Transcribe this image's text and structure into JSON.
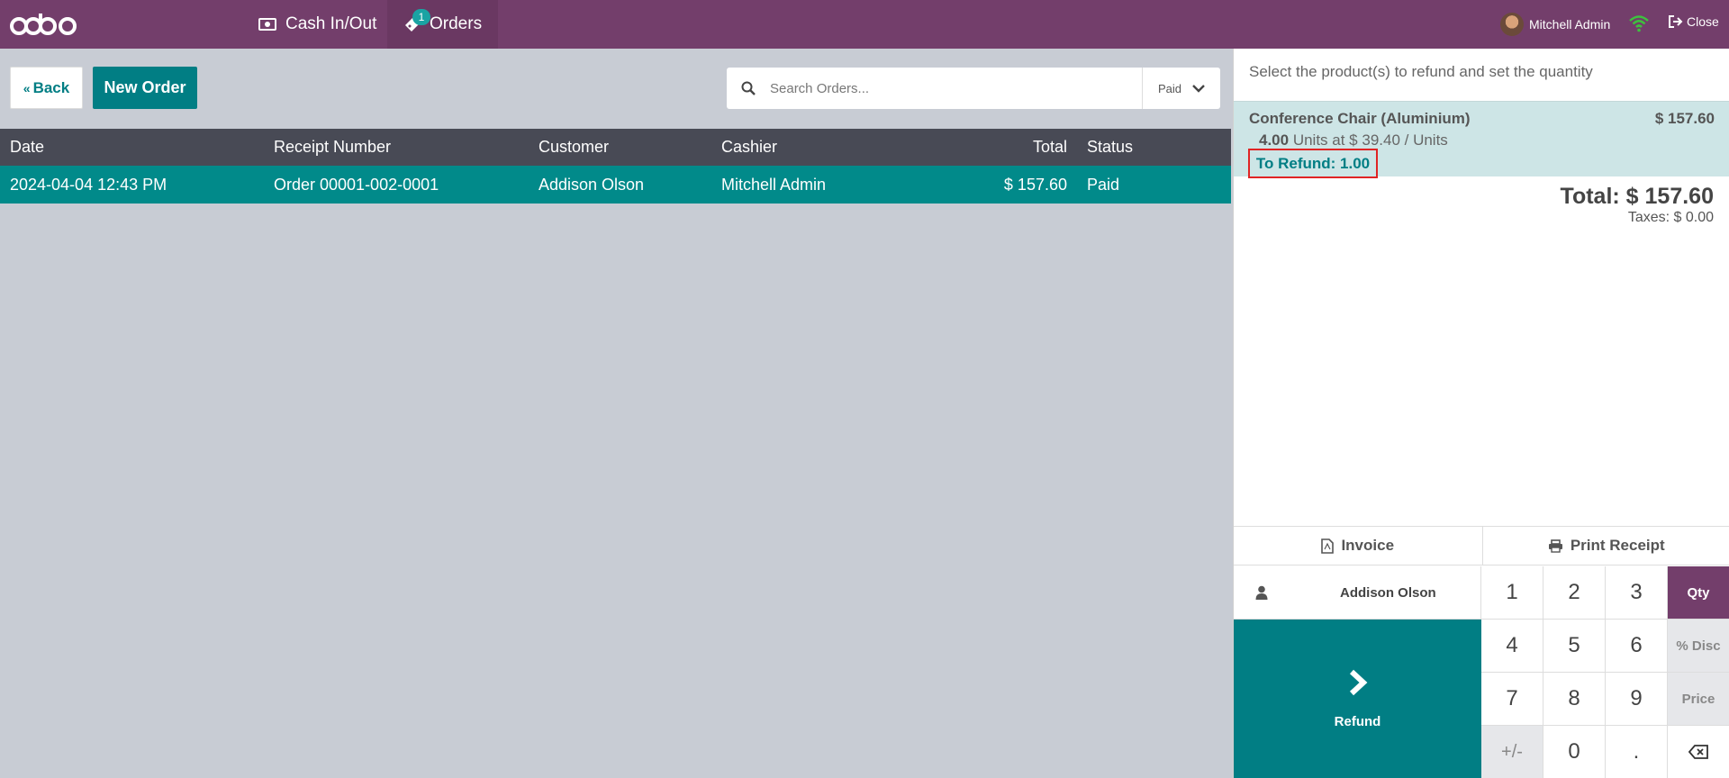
{
  "navbar": {
    "logo": "odoo",
    "cash_label": "Cash In/Out",
    "orders_label": "Orders",
    "orders_badge": "1",
    "user_name": "Mitchell Admin",
    "close_label": "Close"
  },
  "controls": {
    "back_label": "Back",
    "new_order_label": "New Order",
    "search_placeholder": "Search Orders...",
    "filter_value": "Paid"
  },
  "table": {
    "headers": {
      "date": "Date",
      "receipt": "Receipt Number",
      "customer": "Customer",
      "cashier": "Cashier",
      "total": "Total",
      "status": "Status"
    },
    "rows": [
      {
        "date": "2024-04-04 12:43 PM",
        "receipt": "Order 00001-002-0001",
        "customer": "Addison Olson",
        "cashier": "Mitchell Admin",
        "total": "$ 157.60",
        "status": "Paid"
      }
    ]
  },
  "refund_panel": {
    "header": "Select the product(s) to refund and set the quantity",
    "line": {
      "product": "Conference Chair (Aluminium)",
      "price": "$ 157.60",
      "qty": "4.00",
      "qty_detail": "Units at $ 39.40 / Units",
      "to_refund": "To Refund: 1.00"
    },
    "total": "Total: $ 157.60",
    "taxes": "Taxes: $ 0.00",
    "invoice_label": "Invoice",
    "print_label": "Print Receipt",
    "customer_name": "Addison Olson",
    "refund_label": "Refund",
    "numpad": [
      "1",
      "2",
      "3",
      "Qty",
      "4",
      "5",
      "6",
      "% Disc",
      "7",
      "8",
      "9",
      "Price",
      "+/-",
      "0",
      "."
    ]
  },
  "colors": {
    "navbar": "#733e6b",
    "accent": "#017e84",
    "selected_row": "#018a8a",
    "table_header": "#484a55",
    "highlight_border": "#e02424"
  }
}
